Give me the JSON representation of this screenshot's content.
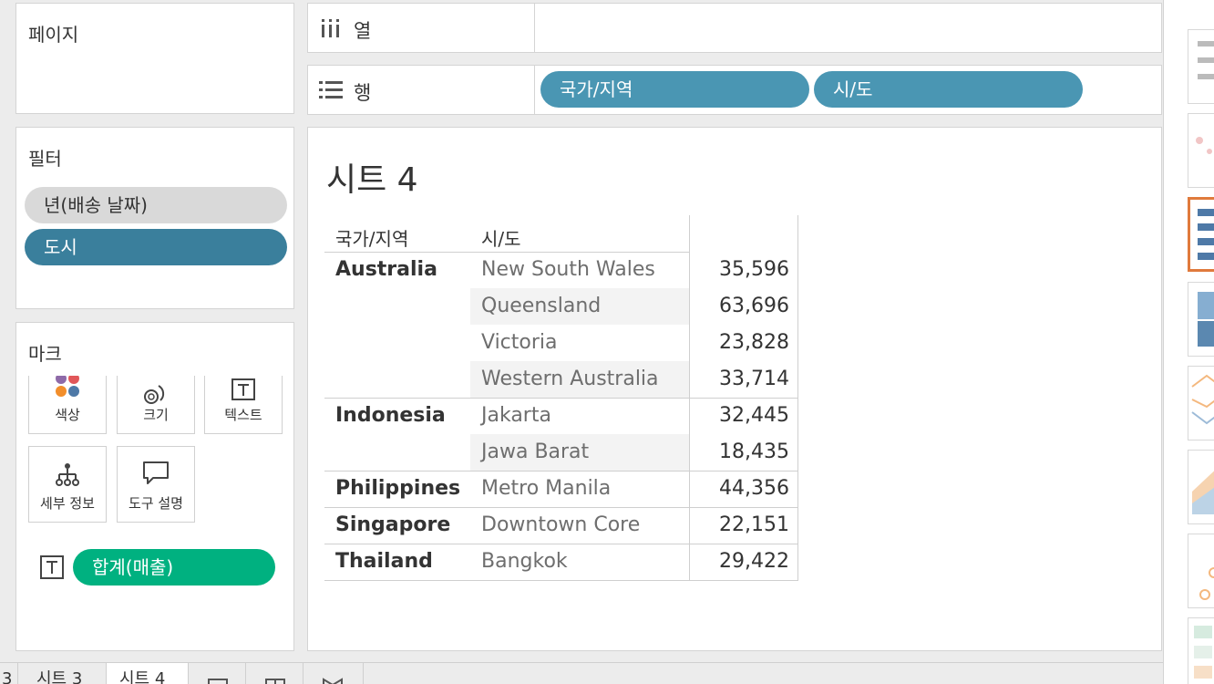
{
  "pages_card": {
    "title": "페이지"
  },
  "filters_card": {
    "title": "필터",
    "pills": [
      {
        "label": "년(배송 날짜)",
        "color": "#d9d9d9"
      },
      {
        "label": "도시",
        "color": "#3a7f9c"
      }
    ]
  },
  "marks_card": {
    "title": "마크",
    "buttons": [
      {
        "label": "색상",
        "icon": "color-dots-icon"
      },
      {
        "label": "크기",
        "icon": "size-icon"
      },
      {
        "label": "텍스트",
        "icon": "text-icon"
      },
      {
        "label": "세부 정보",
        "icon": "detail-icon"
      },
      {
        "label": "도구 설명",
        "icon": "tooltip-icon"
      }
    ],
    "field_pill": {
      "label": "합계(매출)",
      "icon": "text-icon",
      "color": "#00b180"
    }
  },
  "columns_shelf": {
    "label": "열",
    "icon": "columns-icon"
  },
  "rows_shelf": {
    "label": "행",
    "icon": "rows-icon",
    "pills": [
      {
        "label": "국가/지역"
      },
      {
        "label": "시/도"
      }
    ]
  },
  "sheet": {
    "title": "시트 4",
    "headers": {
      "country": "국가/지역",
      "city": "시/도"
    },
    "rows": [
      {
        "country": "Australia",
        "city": "New South Wales",
        "value": "35,596"
      },
      {
        "country": "",
        "city": "Queensland",
        "value": "63,696"
      },
      {
        "country": "",
        "city": "Victoria",
        "value": "23,828"
      },
      {
        "country": "",
        "city": "Western Australia",
        "value": "33,714"
      },
      {
        "country": "Indonesia",
        "city": "Jakarta",
        "value": "32,445"
      },
      {
        "country": "",
        "city": "Jawa Barat",
        "value": "18,435"
      },
      {
        "country": "Philippines",
        "city": "Metro Manila",
        "value": "44,356"
      },
      {
        "country": "Singapore",
        "city": "Downtown Core",
        "value": "22,151"
      },
      {
        "country": "Thailand",
        "city": "Bangkok",
        "value": "29,422"
      }
    ]
  },
  "tabs": [
    {
      "label": "3"
    },
    {
      "label": "시트 3"
    },
    {
      "label": "시트 4"
    }
  ],
  "colors": {
    "accent_shelf": "#4a96b3",
    "dimension_blue": "#3a7f9c",
    "measure_green": "#00b180",
    "active_chart": "#e07a3c"
  }
}
